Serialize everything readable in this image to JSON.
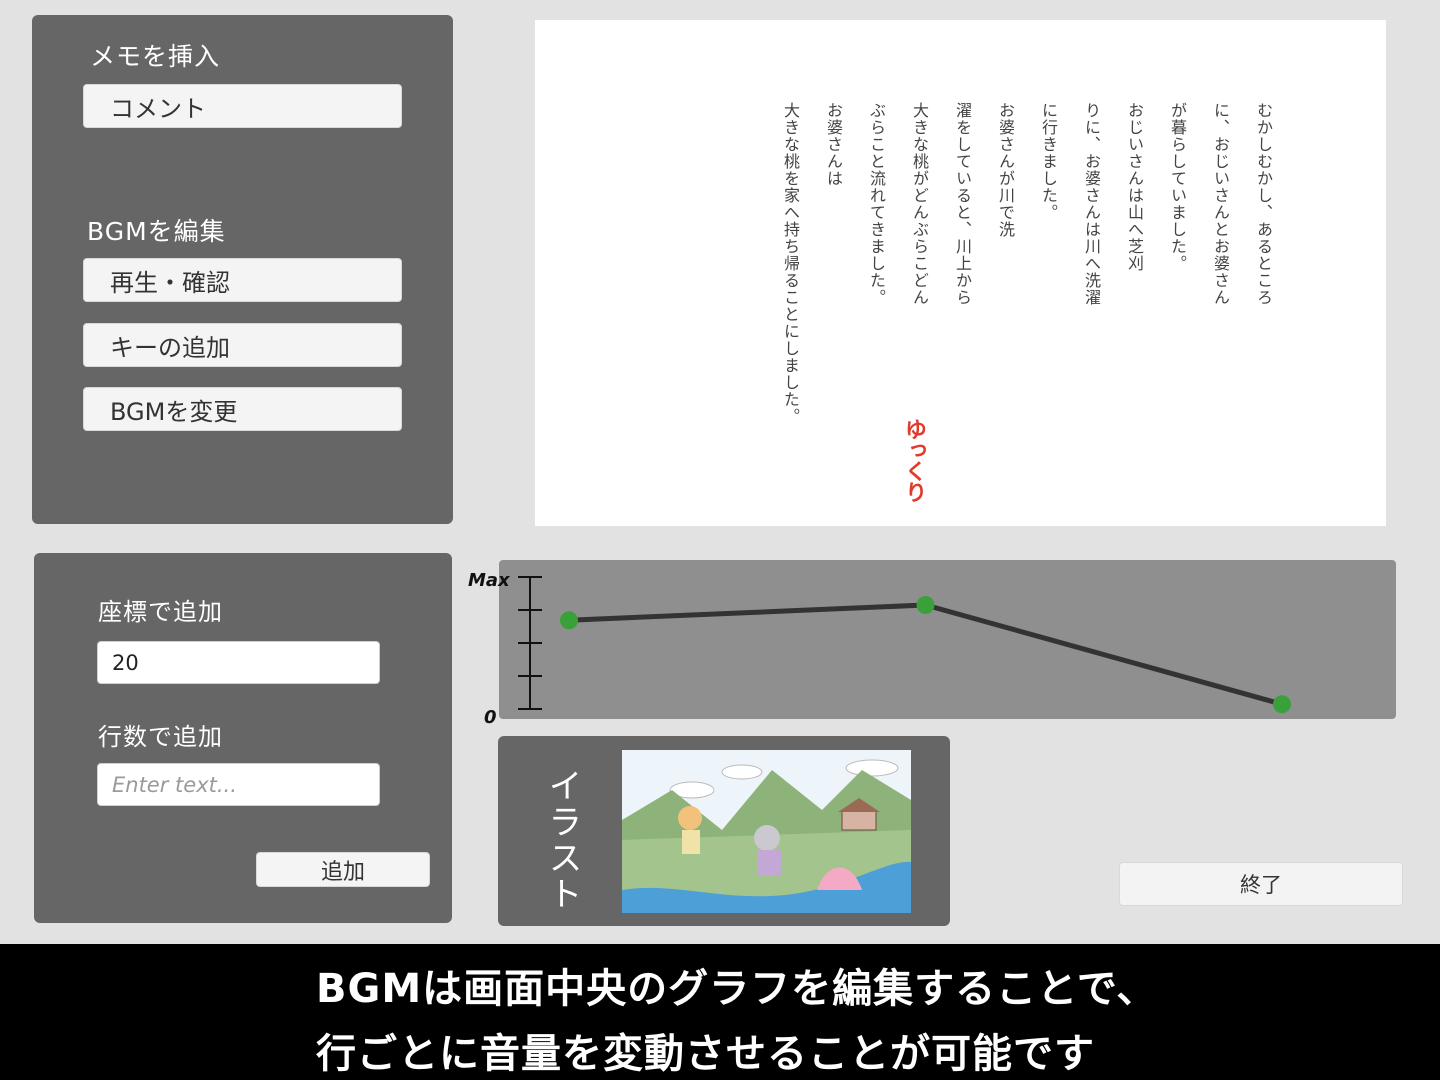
{
  "memo_panel": {
    "title": "メモを挿入",
    "comment_button": "コメント",
    "bgm_title": "BGMを編集",
    "play_button": "再生・確認",
    "add_key_button": "キーの追加",
    "change_bgm_button": "BGMを変更"
  },
  "document": {
    "columns": [
      "むかしむかし、あるところ",
      "に、おじいさんとお婆さん",
      "が暮らしていました。",
      "おじいさんは山へ芝刈",
      "りに、お婆さんは川へ洗濯",
      "に行きました。",
      "お婆さんが川で洗",
      "濯をしていると、川上から",
      "大きな桃がどんぶらこどん",
      "ぶらこと流れてきました。",
      "お婆さんは",
      "大きな桃を家へ持ち帰ることにしました。"
    ],
    "speaker": "ゆっくり",
    "speaker_color": "#e23a2c"
  },
  "add_panel": {
    "coord_title": "座標で追加",
    "coord_value": "20",
    "line_title": "行数で追加",
    "line_placeholder": "Enter text...",
    "add_button": "追加"
  },
  "graph": {
    "max_label": "Max",
    "zero_label": "0",
    "point_color": "#3aa13a",
    "line_color": "#333333"
  },
  "chart_data": {
    "type": "line",
    "title": "",
    "y_tick_labels": [
      "0",
      "Max"
    ],
    "series": [
      {
        "points": [
          {
            "x": 0.0,
            "y": 0.86
          },
          {
            "x": 0.5,
            "y": 1.0
          },
          {
            "x": 1.0,
            "y": 0.09
          }
        ]
      }
    ],
    "ylim": [
      0,
      1
    ]
  },
  "illustration": {
    "label": "イラスト"
  },
  "exit_button": "終了",
  "subtitle": {
    "line1": "BGMは画面中央のグラフを編集することで、",
    "line2": "行ごとに音量を変動させることが可能です"
  }
}
